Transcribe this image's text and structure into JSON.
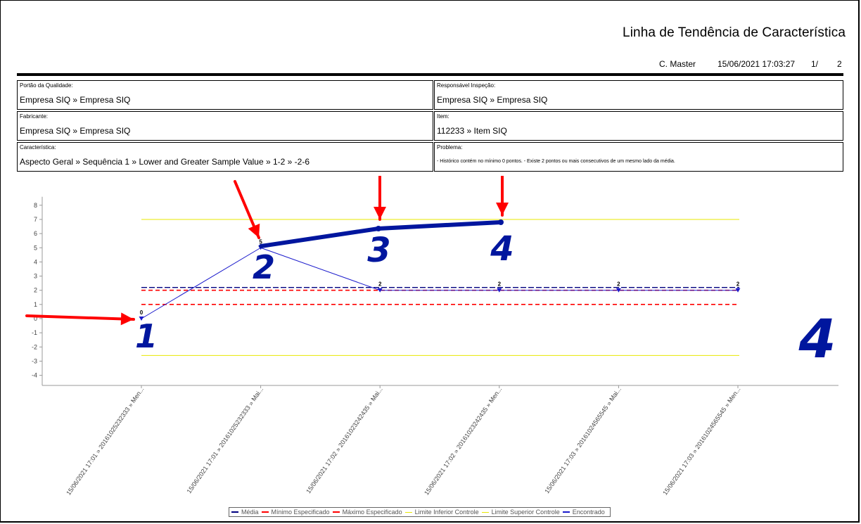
{
  "report": {
    "title": "Linha de Tendência de Característica",
    "user": "C. Master",
    "datetime": "15/06/2021 17:03:27",
    "page": "1/",
    "total_pages": "2"
  },
  "fields": {
    "portao": {
      "label": "Portão da Qualidade:",
      "value": "Empresa SIQ » Empresa SIQ"
    },
    "responsavel": {
      "label": "Responsável Inspeção:",
      "value": "Empresa SIQ » Empresa SIQ"
    },
    "fabricante": {
      "label": "Fabricante:",
      "value": "Empresa SIQ » Empresa SIQ"
    },
    "item": {
      "label": "Item:",
      "value": "112233 » Item SIQ"
    },
    "caracteristica": {
      "label": "Característica:",
      "value": "Aspecto Geral » Sequência 1 » Lower and Greater Sample Value » 1-2 » -2-6"
    },
    "problema": {
      "label": "Problema:",
      "value": " - Histórico contém no mínimo 0 pontos. - Existe 2 pontos ou mais consecutivos de um mesmo lado da média."
    }
  },
  "chart_data": {
    "type": "line",
    "categories": [
      "15/06/2021 17:01 » 20161025232333 » Men...",
      "15/06/2021 17:01 » 20161025232333 » Mai...",
      "15/06/2021 17:02 » 20161023242435 » Mai...",
      "15/06/2021 17:02 » 20161023242435 » Men...",
      "15/06/2021 17:03 » 20161024565545 » Mai...",
      "15/06/2021 17:03 » 20161024565545 » Men..."
    ],
    "values": [
      0,
      5,
      2,
      2,
      2,
      2
    ],
    "point_labels": [
      "0",
      "5",
      "2",
      "2",
      "2",
      "2"
    ],
    "ylim": [
      -4,
      8
    ],
    "yticks": [
      "8",
      "7",
      "6",
      "5",
      "4",
      "3",
      "2",
      "1",
      "0",
      "-1",
      "-2",
      "-3",
      "-4"
    ],
    "reference_lines": {
      "media": 2.2,
      "minimo_especificado": 1,
      "maximo_especificado": 2,
      "limite_inferior_controle": -2.6,
      "limite_superior_controle": 7
    },
    "legend": [
      "Média",
      "Mínimo Especificado",
      "Máximo Especificado",
      "Limite Inferior Controle",
      "Limite Superior Controle",
      "Encontrado"
    ],
    "colors": {
      "media": "#000080",
      "minimo": "#ff0000",
      "maximo": "#ff0000",
      "lic": "#e8e800",
      "lsc": "#e8e800",
      "encontrado": "#1a1acc",
      "annotation_arrow": "#ff0000",
      "annotation_ink": "#00169e"
    },
    "annotations": {
      "digits": [
        "1",
        "2",
        "3",
        "4",
        "4"
      ]
    }
  }
}
